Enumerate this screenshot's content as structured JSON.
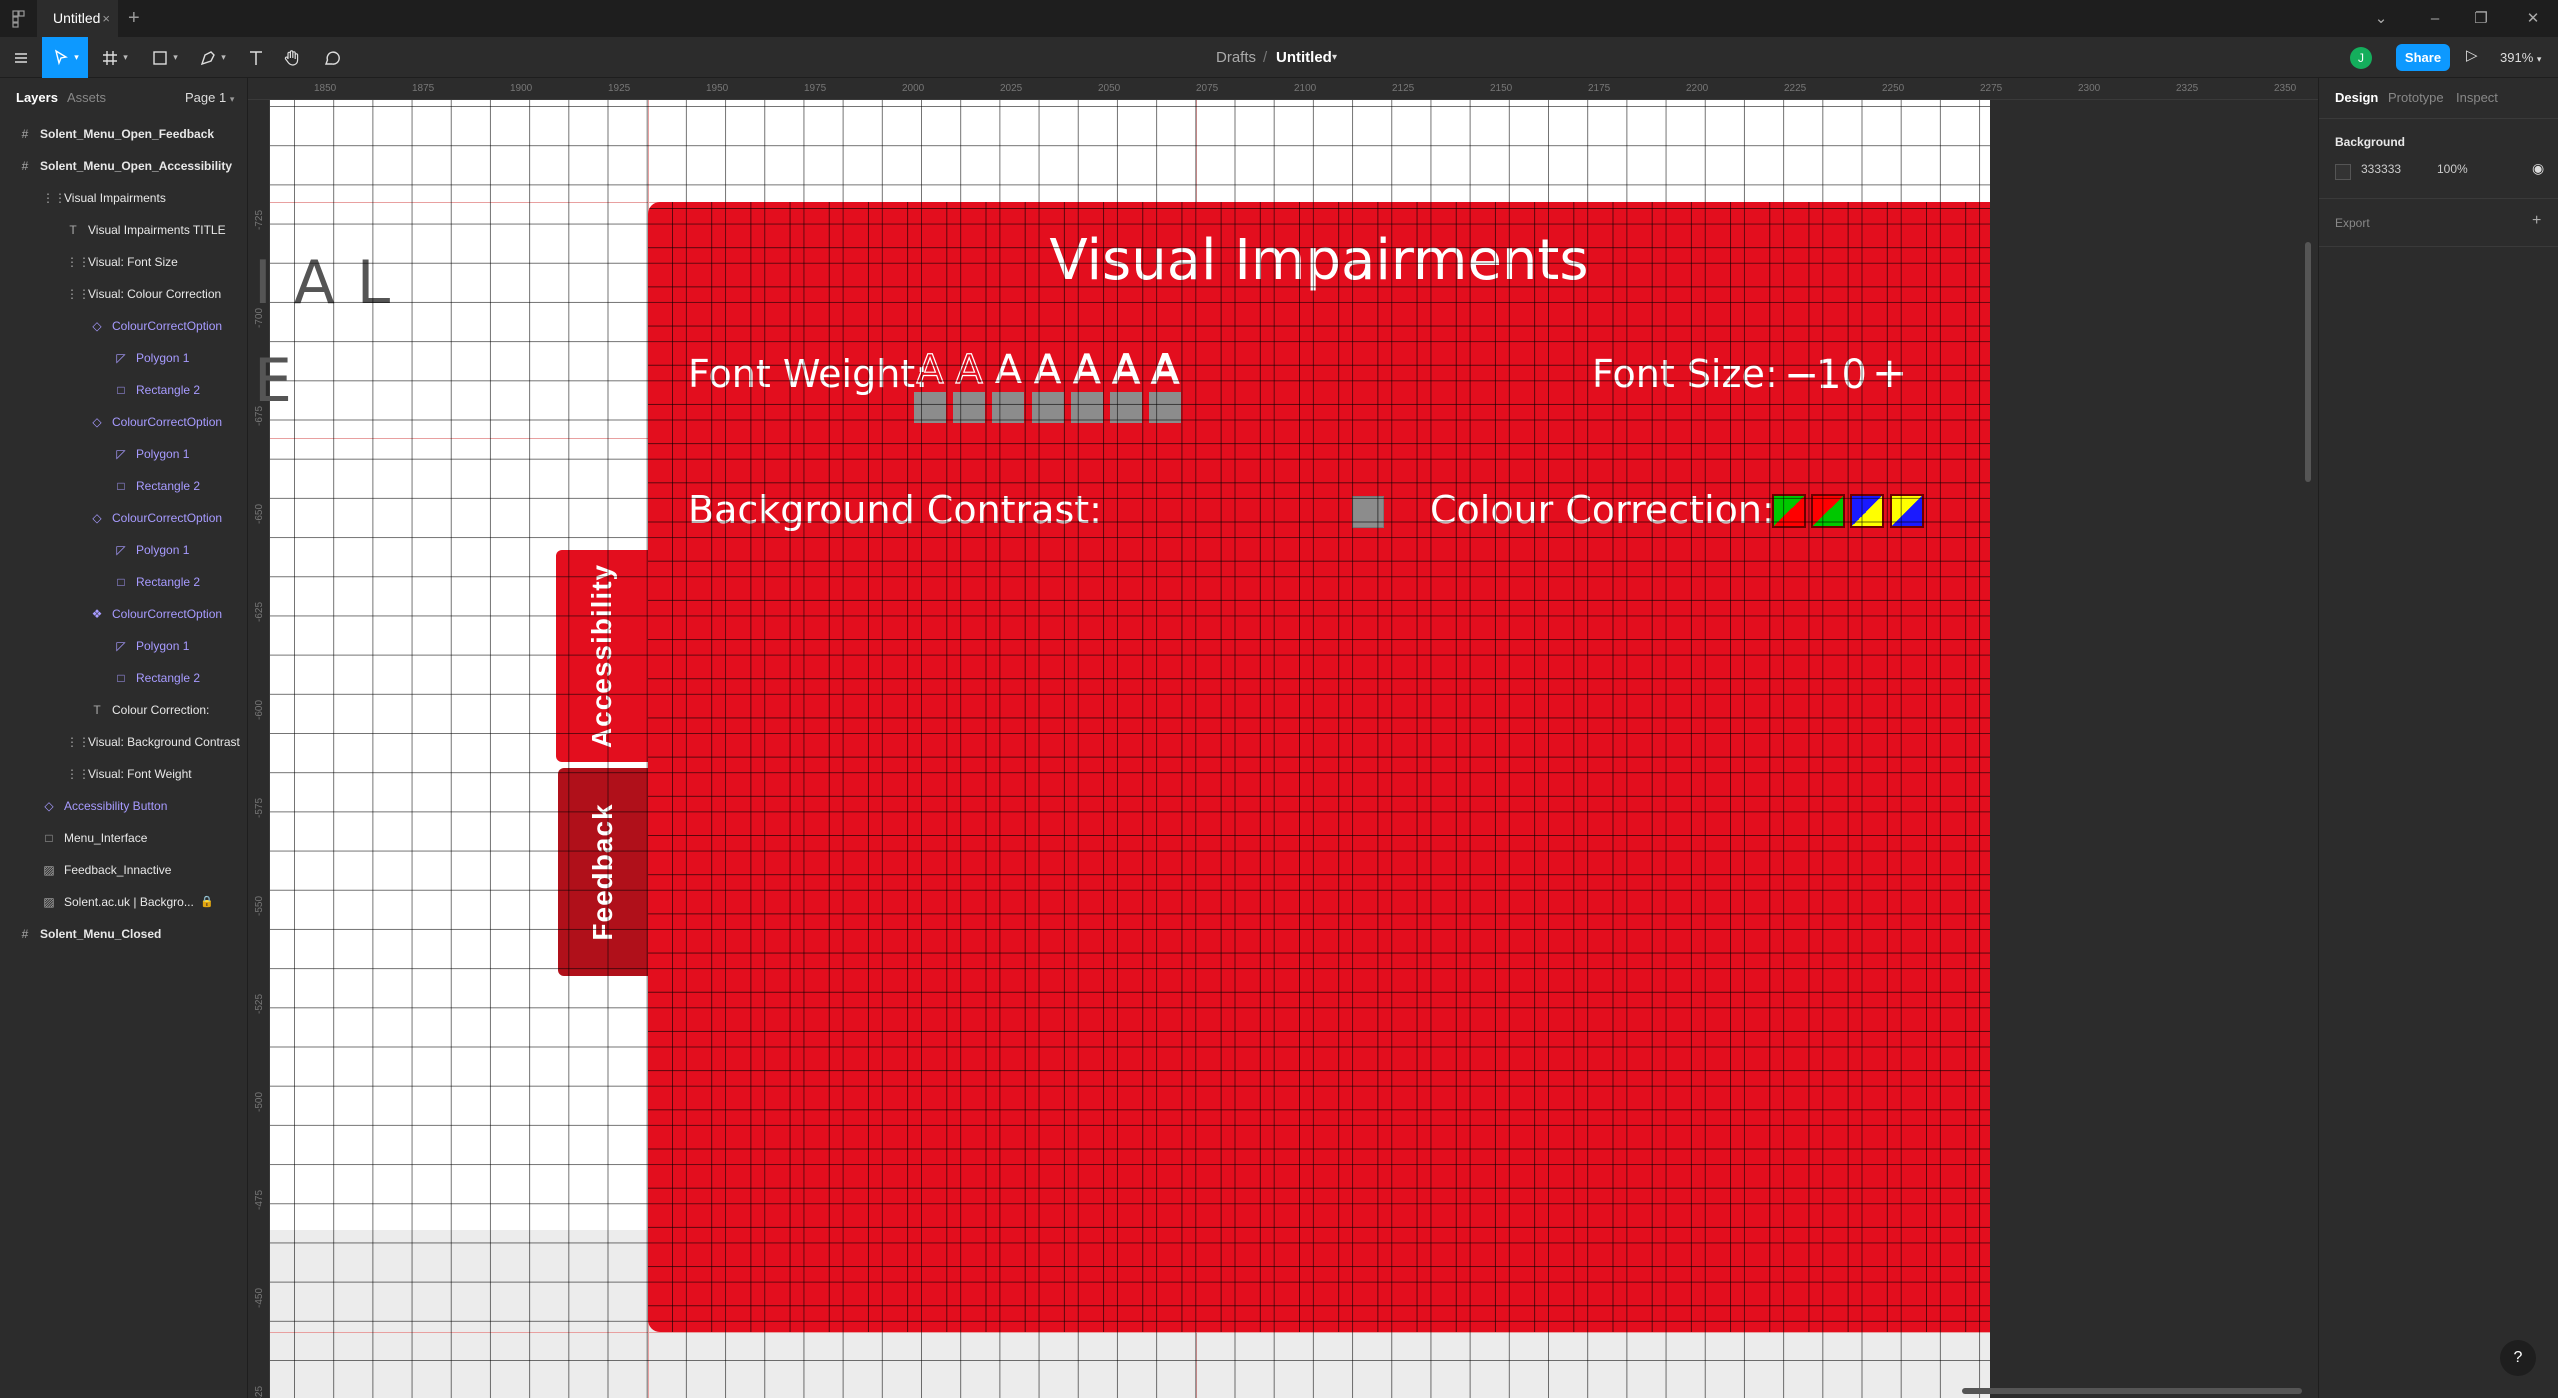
{
  "tabbar": {
    "tab_title": "Untitled",
    "close": "×",
    "new_tab": "+"
  },
  "toolbar": {
    "breadcrumb_parent": "Drafts",
    "breadcrumb_sep": "/",
    "file_name": "Untitled",
    "avatar_initial": "J",
    "share_label": "Share",
    "zoom_level": "391%"
  },
  "left_panel": {
    "tab_layers": "Layers",
    "tab_assets": "Assets",
    "page": "Page 1",
    "layers": [
      {
        "label": "Solent_Menu_Open_Feedback",
        "icon": "#",
        "indent": 0,
        "kind": "frame"
      },
      {
        "label": "Solent_Menu_Open_Accessibility",
        "icon": "#",
        "indent": 0,
        "kind": "frame"
      },
      {
        "label": "Visual Impairments",
        "icon": "⋮⋮",
        "indent": 1,
        "kind": "group"
      },
      {
        "label": "Visual Impairments TITLE",
        "icon": "T",
        "indent": 2,
        "kind": "text"
      },
      {
        "label": "Visual: Font Size",
        "icon": "⋮⋮",
        "indent": 2,
        "kind": "group"
      },
      {
        "label": "Visual: Colour Correction",
        "icon": "⋮⋮",
        "indent": 2,
        "kind": "group"
      },
      {
        "label": "ColourCorrectOption",
        "icon": "◇",
        "indent": 3,
        "kind": "comp"
      },
      {
        "label": "Polygon 1",
        "icon": "◸",
        "indent": 4,
        "kind": "comp"
      },
      {
        "label": "Rectangle 2",
        "icon": "□",
        "indent": 4,
        "kind": "comp"
      },
      {
        "label": "ColourCorrectOption",
        "icon": "◇",
        "indent": 3,
        "kind": "comp"
      },
      {
        "label": "Polygon 1",
        "icon": "◸",
        "indent": 4,
        "kind": "comp"
      },
      {
        "label": "Rectangle 2",
        "icon": "□",
        "indent": 4,
        "kind": "comp"
      },
      {
        "label": "ColourCorrectOption",
        "icon": "◇",
        "indent": 3,
        "kind": "comp"
      },
      {
        "label": "Polygon 1",
        "icon": "◸",
        "indent": 4,
        "kind": "comp"
      },
      {
        "label": "Rectangle 2",
        "icon": "□",
        "indent": 4,
        "kind": "comp"
      },
      {
        "label": "ColourCorrectOption",
        "icon": "❖",
        "indent": 3,
        "kind": "comp"
      },
      {
        "label": "Polygon 1",
        "icon": "◸",
        "indent": 4,
        "kind": "comp"
      },
      {
        "label": "Rectangle 2",
        "icon": "□",
        "indent": 4,
        "kind": "comp"
      },
      {
        "label": "Colour Correction:",
        "icon": "T",
        "indent": 3,
        "kind": "text"
      },
      {
        "label": "Visual: Background Contrast",
        "icon": "⋮⋮",
        "indent": 2,
        "kind": "group"
      },
      {
        "label": "Visual: Font Weight",
        "icon": "⋮⋮",
        "indent": 2,
        "kind": "group"
      },
      {
        "label": "Accessibility Button",
        "icon": "◇",
        "indent": 1,
        "kind": "comp"
      },
      {
        "label": "Menu_Interface",
        "icon": "□",
        "indent": 1,
        "kind": "rect"
      },
      {
        "label": "Feedback_Innactive",
        "icon": "▨",
        "indent": 1,
        "kind": "image"
      },
      {
        "label": "Solent.ac.uk | Backgro...",
        "icon": "▨",
        "indent": 1,
        "kind": "image",
        "locked": true
      },
      {
        "label": "Solent_Menu_Closed",
        "icon": "#",
        "indent": 0,
        "kind": "frame"
      }
    ]
  },
  "rulers": {
    "horizontal": [
      "1850",
      "1875",
      "1900",
      "1925",
      "1950",
      "1975",
      "2000",
      "2025",
      "2050",
      "2075",
      "2100",
      "2125",
      "2150",
      "2175",
      "2200",
      "2225",
      "2250",
      "2275",
      "2300",
      "2325",
      "2350"
    ],
    "vertical": [
      "-725",
      "-700",
      "-675",
      "-650",
      "-625",
      "-600",
      "-575",
      "-550",
      "-525",
      "-500",
      "-475",
      "-450",
      "-425"
    ]
  },
  "canvas": {
    "ghost_line1": "IAL",
    "ghost_line2": "E",
    "tab_accessibility": "Accessibility",
    "tab_feedback": "Feedback",
    "menu_title": "Visual Impairments",
    "font_weight_label": "Font Weight:",
    "font_weight_glyph": "A",
    "font_size_label": "Font Size:",
    "font_size_minus": "−",
    "font_size_value": "10",
    "font_size_plus": "+",
    "background_contrast_label": "Background Contrast:",
    "colour_correction_label": "Colour Correction:",
    "colour_options": [
      {
        "top": "#00c800",
        "bottom": "#ff0000"
      },
      {
        "top": "#ff0000",
        "bottom": "#00c800"
      },
      {
        "top": "#1a1aff",
        "bottom": "#ffff00"
      },
      {
        "top": "#ffff00",
        "bottom": "#1a1aff"
      }
    ],
    "menu_color": "#e30e1e",
    "feedback_tab_color": "#b0101a"
  },
  "right_panel": {
    "tab_design": "Design",
    "tab_prototype": "Prototype",
    "tab_inspect": "Inspect",
    "background_heading": "Background",
    "background_hex": "333333",
    "background_opacity": "100%",
    "export_heading": "Export",
    "export_add": "+"
  },
  "help": "?"
}
